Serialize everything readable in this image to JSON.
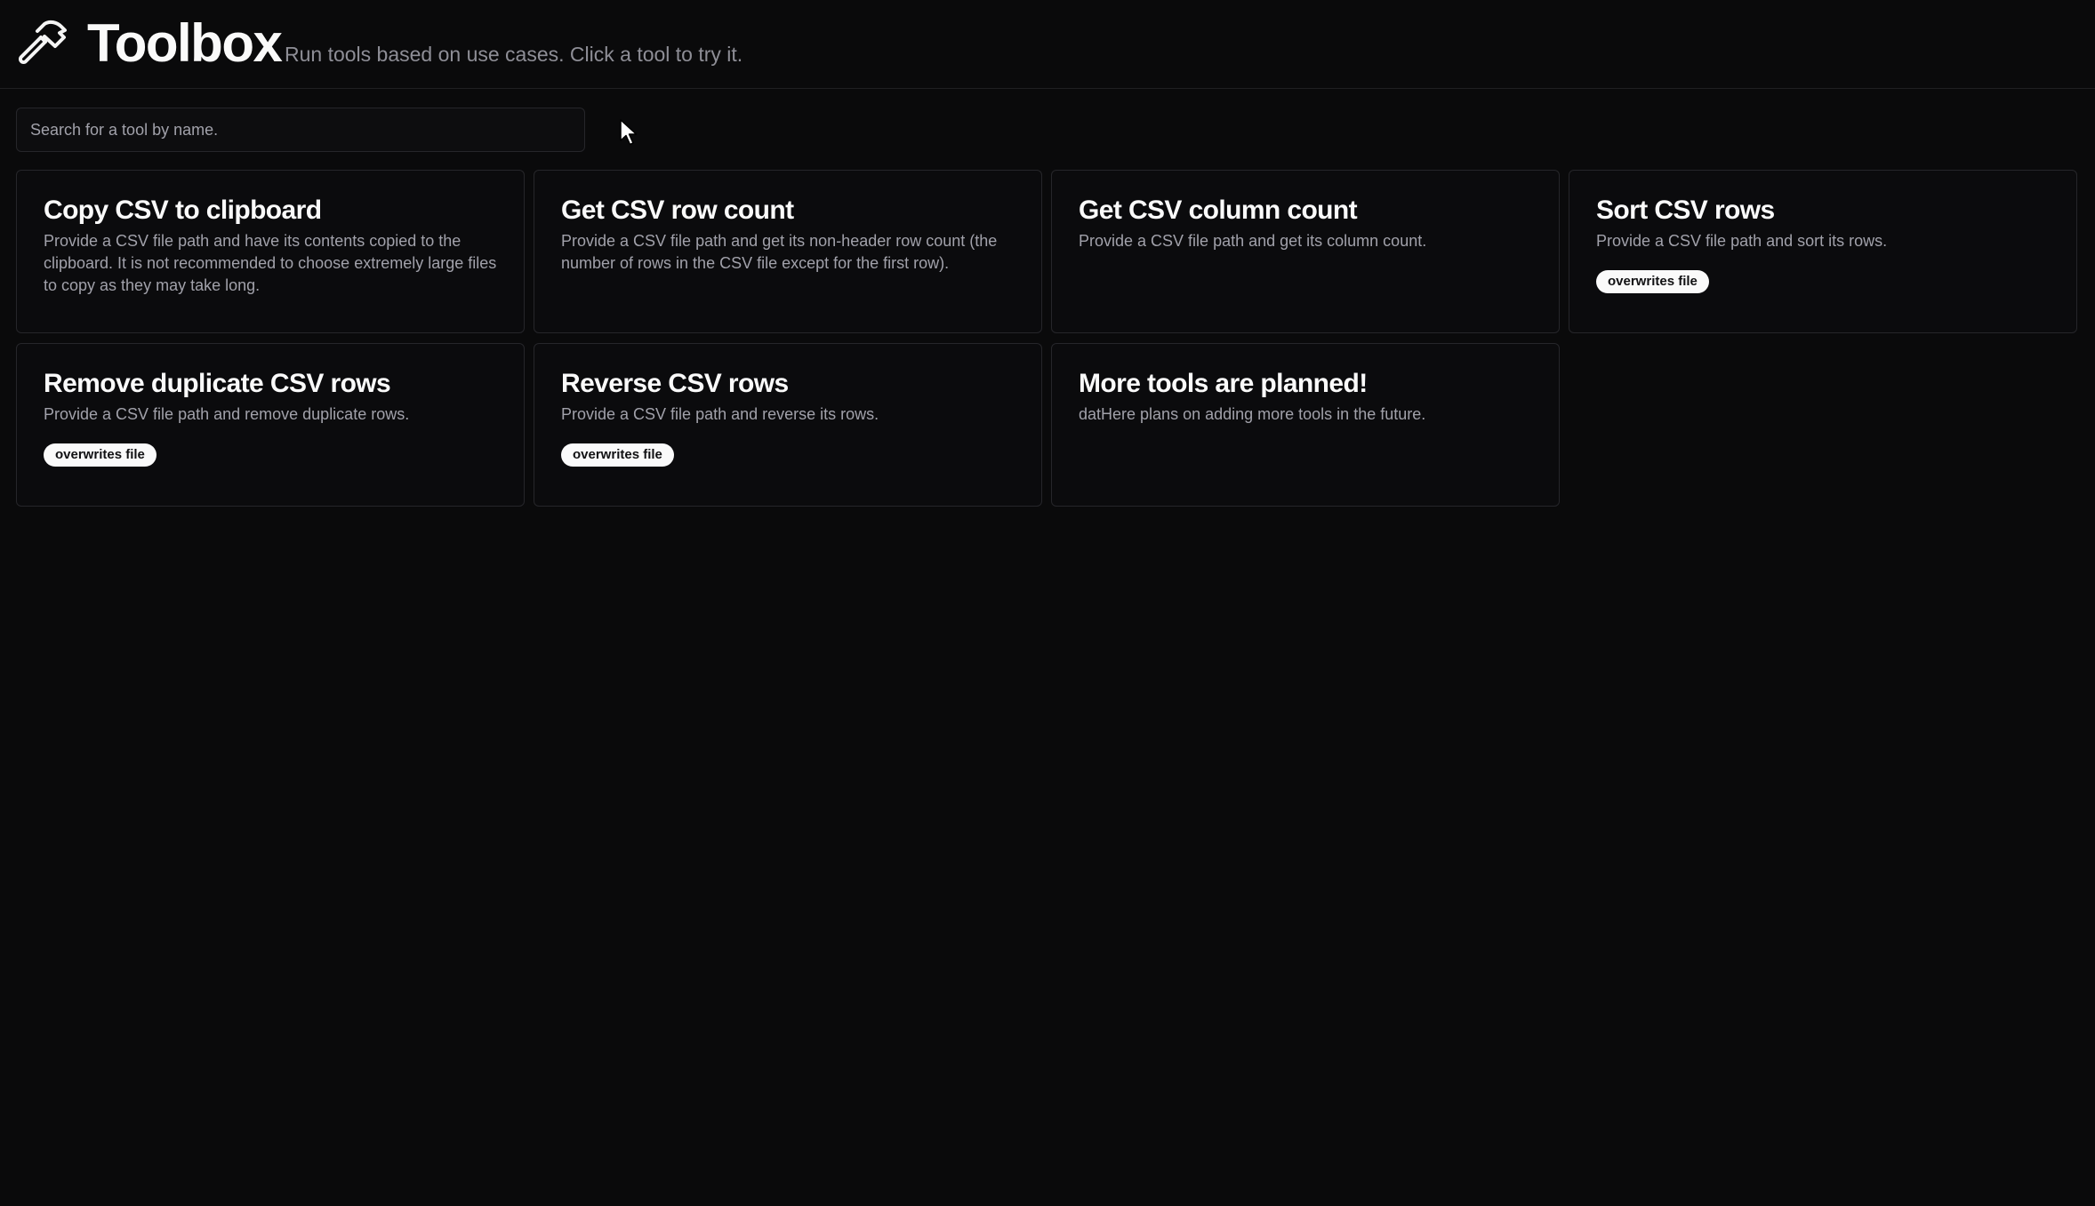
{
  "header": {
    "title": "Toolbox",
    "subtitle": "Run tools based on use cases. Click a tool to try it.",
    "icon": "hammer-icon"
  },
  "search": {
    "placeholder": "Search for a tool by name.",
    "value": ""
  },
  "tools": [
    {
      "title": "Copy CSV to clipboard",
      "description": "Provide a CSV file path and have its contents copied to the clipboard. It is not recommended to choose extremely large files to copy as they may take long.",
      "badge": ""
    },
    {
      "title": "Get CSV row count",
      "description": "Provide a CSV file path and get its non-header row count (the number of rows in the CSV file except for the first row).",
      "badge": ""
    },
    {
      "title": "Get CSV column count",
      "description": "Provide a CSV file path and get its column count.",
      "badge": ""
    },
    {
      "title": "Sort CSV rows",
      "description": "Provide a CSV file path and sort its rows.",
      "badge": "overwrites file"
    },
    {
      "title": "Remove duplicate CSV rows",
      "description": "Provide a CSV file path and remove duplicate rows.",
      "badge": "overwrites file"
    },
    {
      "title": "Reverse CSV rows",
      "description": "Provide a CSV file path and reverse its rows.",
      "badge": "overwrites file"
    },
    {
      "title": "More tools are planned!",
      "description": "datHere plans on adding more tools in the future.",
      "badge": ""
    }
  ],
  "colors": {
    "background": "#0a0a0b",
    "card_border": "#26262a",
    "title": "#fafafa",
    "muted_text": "#a1a1aa",
    "badge_bg": "#fafafa",
    "badge_text": "#111113"
  }
}
